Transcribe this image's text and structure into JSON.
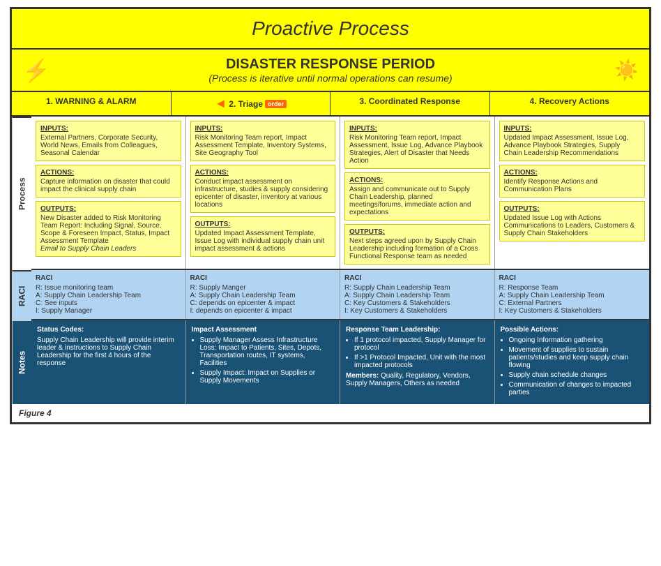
{
  "header": {
    "proactive_title": "Proactive Process",
    "disaster_title": "DISASTER RESPONSE PERIOD",
    "disaster_subtitle": "(Process is iterative until normal operations can resume)"
  },
  "columns": [
    {
      "id": "col1",
      "label": "1. WARNING & ALARM"
    },
    {
      "id": "col2",
      "label": "2. Triage",
      "has_order": true
    },
    {
      "id": "col3",
      "label": "3. Coordinated Response"
    },
    {
      "id": "col4",
      "label": "4. Recovery Actions"
    }
  ],
  "row_labels": [
    "Process",
    "RACI",
    "Notes"
  ],
  "process": [
    {
      "col": "col1",
      "inputs_title": "INPUTS:",
      "inputs_body": "External Partners, Corporate Security, World News, Emails from Colleagues, Seasonal Calendar",
      "actions_title": "ACTIONS:",
      "actions_body": "Capture information on disaster that could impact the clinical supply chain",
      "outputs_title": "OUTPUTS:",
      "outputs_body": "New Disaster added to Risk Monitoring Team Report: Including Signal, Source, Scope & Foreseen Impact, Status, Impact Assessment Template",
      "outputs_italic": "Email to Supply Chain Leaders"
    },
    {
      "col": "col2",
      "inputs_title": "INPUTS:",
      "inputs_body": "Risk Monitoring Team report, Impact Assessment Template, Inventory Systems, Site Geography Tool",
      "actions_title": "ACTIONS:",
      "actions_body": "Conduct impact assessment on infrastructure, studies & supply considering epicenter of disaster, inventory at various locations",
      "outputs_title": "OUTPUTS:",
      "outputs_body": "Updated Impact Assessment Template, Issue Log with individual supply chain unit impact assessment & actions"
    },
    {
      "col": "col3",
      "inputs_title": "INPUTS:",
      "inputs_body": "Risk Monitoring Team report, Impact Assessment, Issue Log, Advance Playbook Strategies, Alert of Disaster that Needs Action",
      "actions_title": "ACTIONS:",
      "actions_body": "Assign and communicate out to Supply Chain Leadership, planned meetings/forums, immediate action and expectations",
      "outputs_title": "OUTPUTS:",
      "outputs_body": "Next steps agreed upon by Supply Chain Leadership including formation of a Cross Functional Response team as needed"
    },
    {
      "col": "col4",
      "inputs_title": "INPUTS:",
      "inputs_body": "Updated Impact Assessment, Issue Log, Advance Playbook Strategies, Supply Chain Leadership Recommendations",
      "actions_title": "ACTIONS:",
      "actions_body": "Identify Response Actions and Communication Plans",
      "outputs_title": "OUTPUTS:",
      "outputs_body": "Updated Issue Log with Actions Communications to Leaders, Customers & Supply Chain Stakeholders"
    }
  ],
  "raci": [
    {
      "col": "col1",
      "title": "RACI",
      "r": "R: Issue monitoring team",
      "a": "A: Supply Chain Leadership Team",
      "c": "C: See inputs",
      "i": "I: Supply Manager"
    },
    {
      "col": "col2",
      "title": "RACI",
      "r": "R: Supply Manger",
      "a": "A: Supply Chain Leadership Team",
      "c": "C: depends on epicenter & impact",
      "i": "I: depends on epicenter & impact"
    },
    {
      "col": "col3",
      "title": "RACI",
      "r": "R: Supply Chain Leadership Team",
      "a": "A: Supply Chain Leadership Team",
      "c": "C: Key Customers & Stakeholders",
      "i": "I: Key Customers & Stakeholders"
    },
    {
      "col": "col4",
      "title": "RACI",
      "r": "R: Response Team",
      "a": "A: Supply Chain Leadership Team",
      "c": "C: External Partners",
      "i": "I: Key Customers & Stakeholders"
    }
  ],
  "notes": [
    {
      "col": "col1",
      "title": "Status Codes:",
      "body": "Supply Chain Leadership will provide interim leader & instructions to Supply Chain Leadership for the first 4 hours of the response",
      "is_list": false
    },
    {
      "col": "col2",
      "title": "Impact Assessment",
      "items": [
        "Supply Manager Assess Infrastructure Loss: Impact to Patients, Sites, Depots, Transportation routes, IT systems, Facilities",
        "Supply Impact: Impact on Supplies or Supply Movements"
      ],
      "is_list": true
    },
    {
      "col": "col3",
      "title": "Response Team Leadership:",
      "sub_items": [
        "If 1 protocol impacted, Supply Manager for protocol",
        "If >1 Protocol Impacted, Unit with the most impacted protocols"
      ],
      "members_label": "Members:",
      "members_body": "Quality, Regulatory, Vendors, Supply Managers, Others as needed",
      "is_mixed": true
    },
    {
      "col": "col4",
      "title": "Possible Actions:",
      "items": [
        "Ongoing Information gathering",
        "Movement of supplies to sustain patients/studies and keep supply chain flowing",
        "Supply chain schedule changes",
        "Communication of changes to impacted parties"
      ],
      "is_list": true
    }
  ],
  "figure_label": "Figure 4"
}
